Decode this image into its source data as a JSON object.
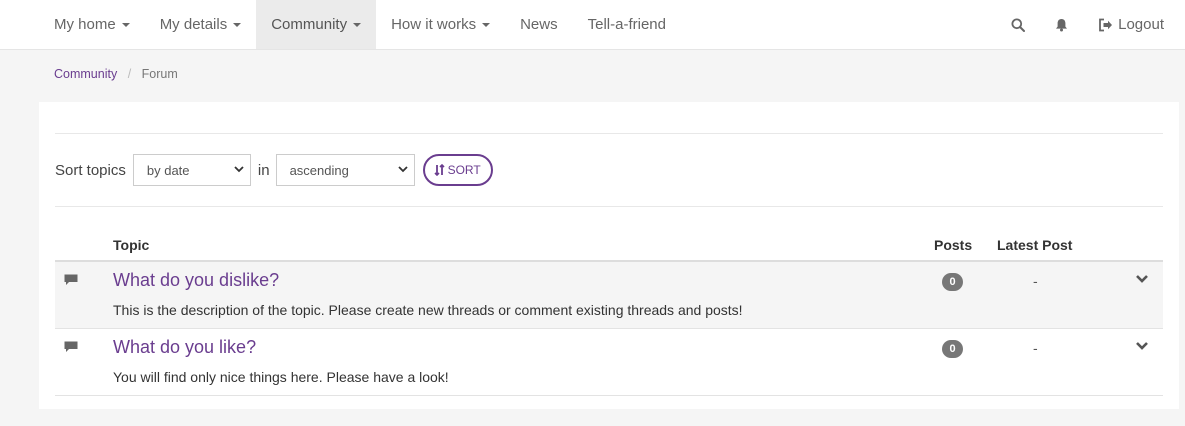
{
  "nav": {
    "items": [
      {
        "label": "My home",
        "dropdown": true
      },
      {
        "label": "My details",
        "dropdown": true
      },
      {
        "label": "Community",
        "dropdown": true,
        "active": true
      },
      {
        "label": "How it works",
        "dropdown": true
      },
      {
        "label": "News",
        "dropdown": false
      },
      {
        "label": "Tell-a-friend",
        "dropdown": false
      }
    ],
    "search_icon": "search-icon",
    "bell_icon": "bell-icon",
    "logout_label": "Logout"
  },
  "breadcrumb": {
    "items": [
      "Community",
      "Forum"
    ],
    "separator": "/"
  },
  "sort": {
    "label": "Sort topics",
    "field_value": "by date",
    "in_label": "in",
    "order_value": "ascending",
    "button_label": "SORT"
  },
  "table": {
    "headers": {
      "topic": "Topic",
      "posts": "Posts",
      "latest": "Latest Post"
    },
    "rows": [
      {
        "title": "What do you dislike?",
        "description": "This is the description of the topic. Please create new threads or comment existing threads and posts!",
        "posts": "0",
        "latest": "-"
      },
      {
        "title": "What do you like?",
        "description": "You will find only nice things here. Please have a look!",
        "posts": "0",
        "latest": "-"
      }
    ]
  },
  "colors": {
    "accent": "#6a3d8f",
    "badge": "#777777"
  }
}
